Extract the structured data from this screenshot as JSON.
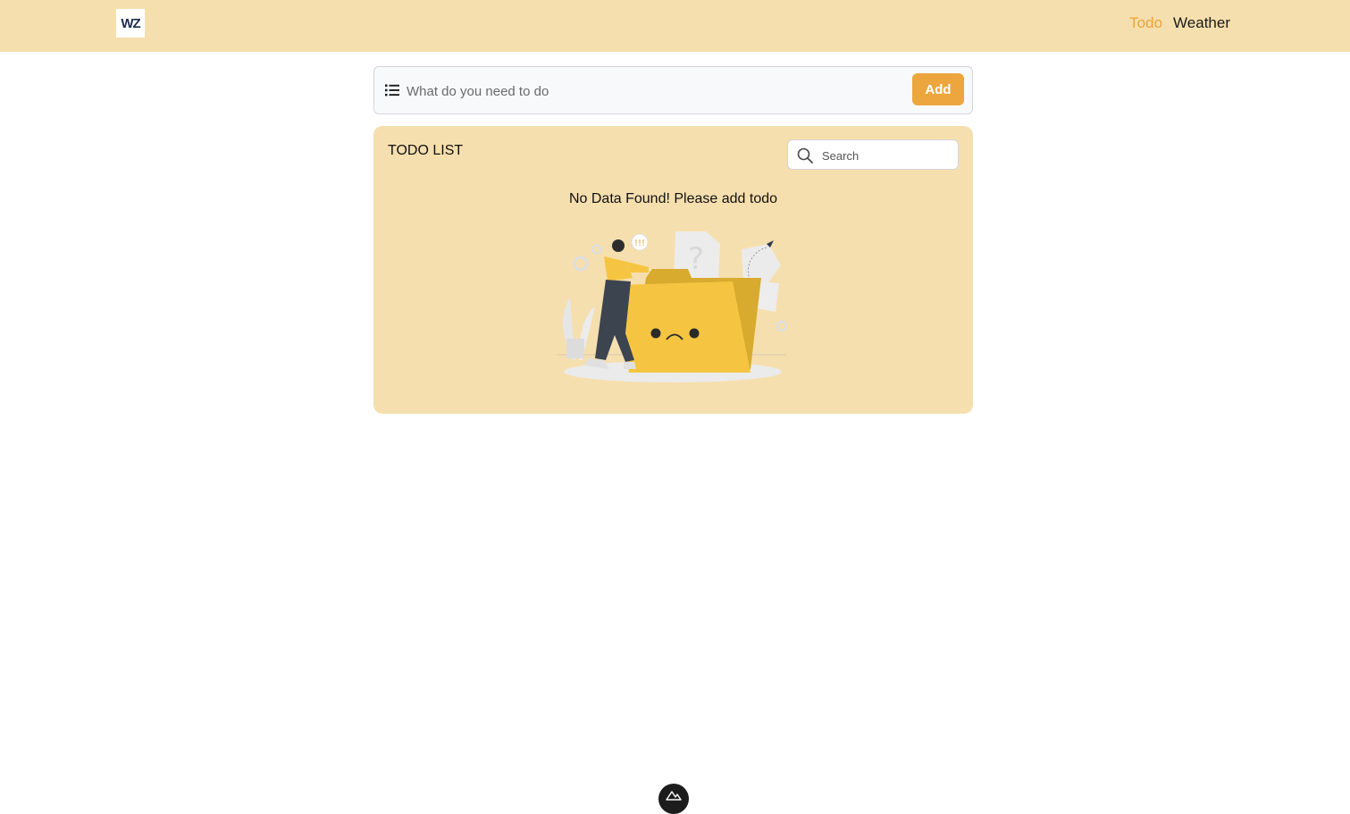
{
  "header": {
    "logo_text": "WZ",
    "nav": [
      {
        "label": "Todo",
        "active": true
      },
      {
        "label": "Weather",
        "active": false
      }
    ]
  },
  "add_bar": {
    "placeholder": "What do you need to do",
    "value": "",
    "add_label": "Add"
  },
  "todo_list": {
    "title": "TODO LIST",
    "search_placeholder": "Search",
    "search_value": "",
    "empty_message": "No Data Found! Please add todo"
  },
  "colors": {
    "header_bg": "#f6dfae",
    "accent": "#eca63d",
    "card_bg": "#f6dfae",
    "active_link": "#eba43a"
  }
}
